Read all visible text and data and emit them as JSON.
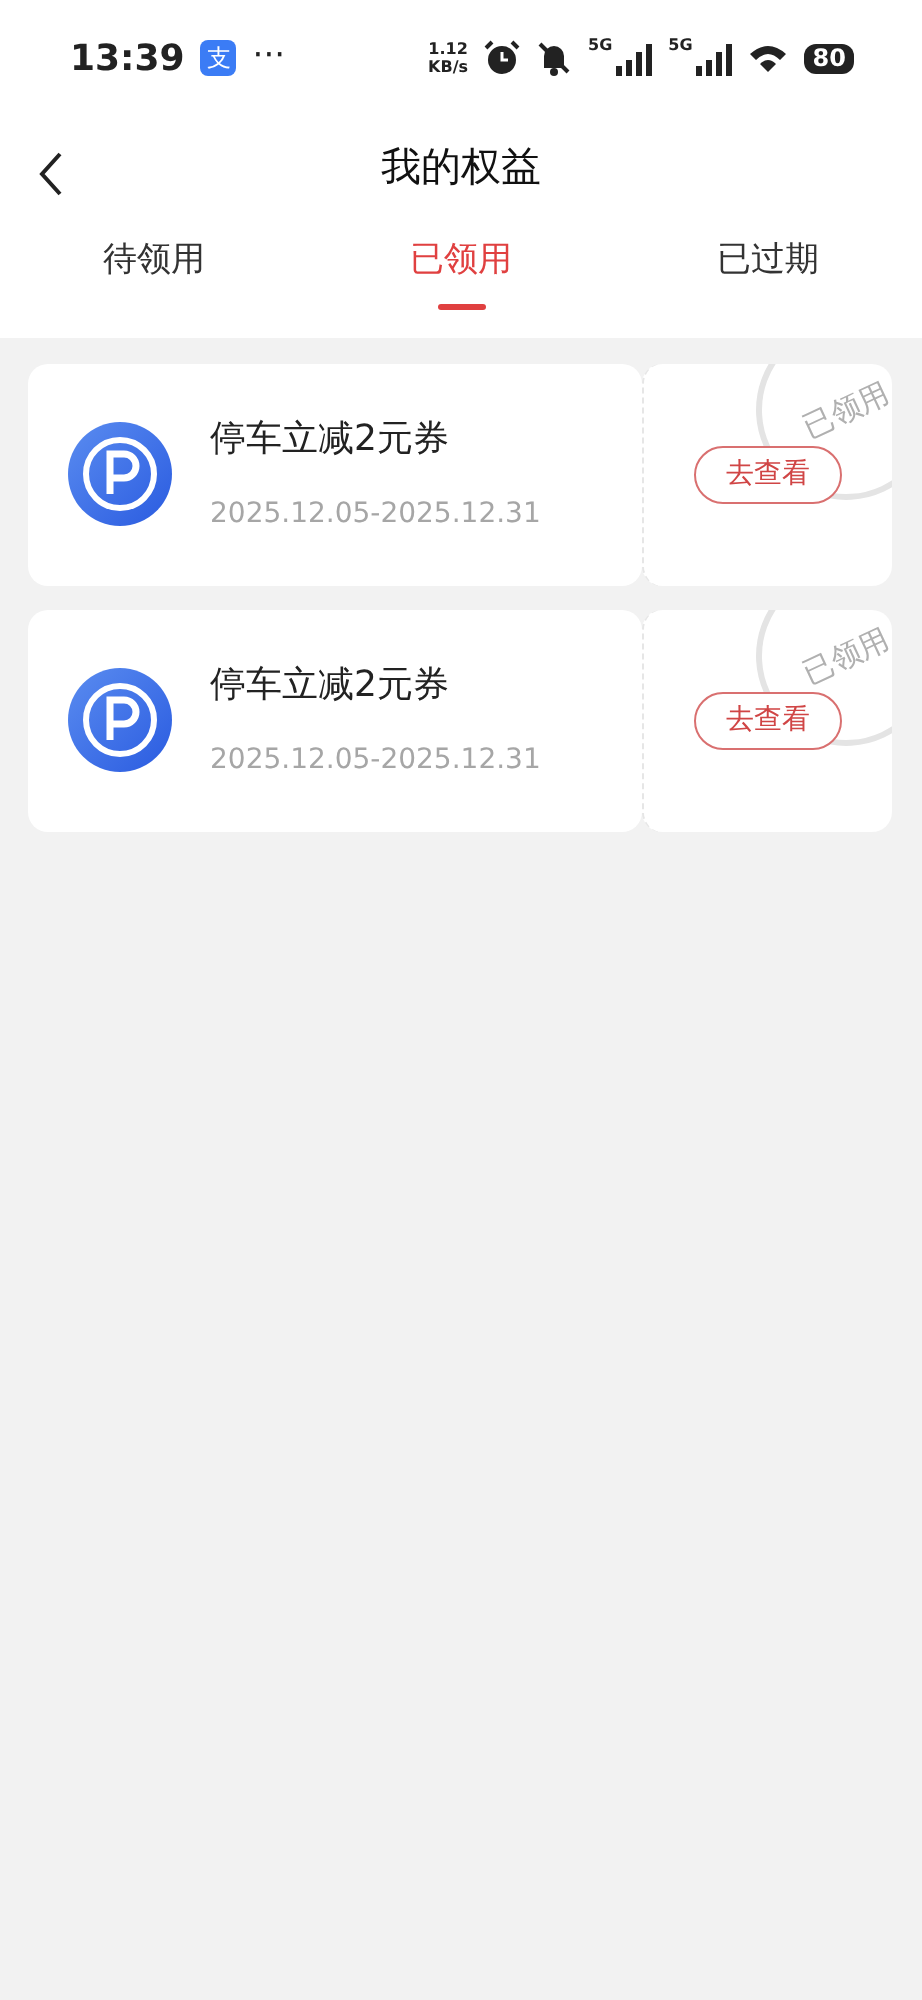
{
  "status_bar": {
    "time": "13:39",
    "app_badge": "支",
    "more": "···",
    "net_speed": "1.12",
    "net_unit": "KB/s",
    "sim1": "5G",
    "sim2": "5G",
    "battery": "80"
  },
  "header": {
    "title": "我的权益"
  },
  "tabs": [
    {
      "label": "待领用",
      "selected": false
    },
    {
      "label": "已领用",
      "selected": true
    },
    {
      "label": "已过期",
      "selected": false
    }
  ],
  "coupons": [
    {
      "title": "停车立减2元券",
      "validity": "2025.12.05-2025.12.31",
      "action": "去查看",
      "stamp": "已领用"
    },
    {
      "title": "停车立减2元券",
      "validity": "2025.12.05-2025.12.31",
      "action": "去查看",
      "stamp": "已领用"
    }
  ]
}
